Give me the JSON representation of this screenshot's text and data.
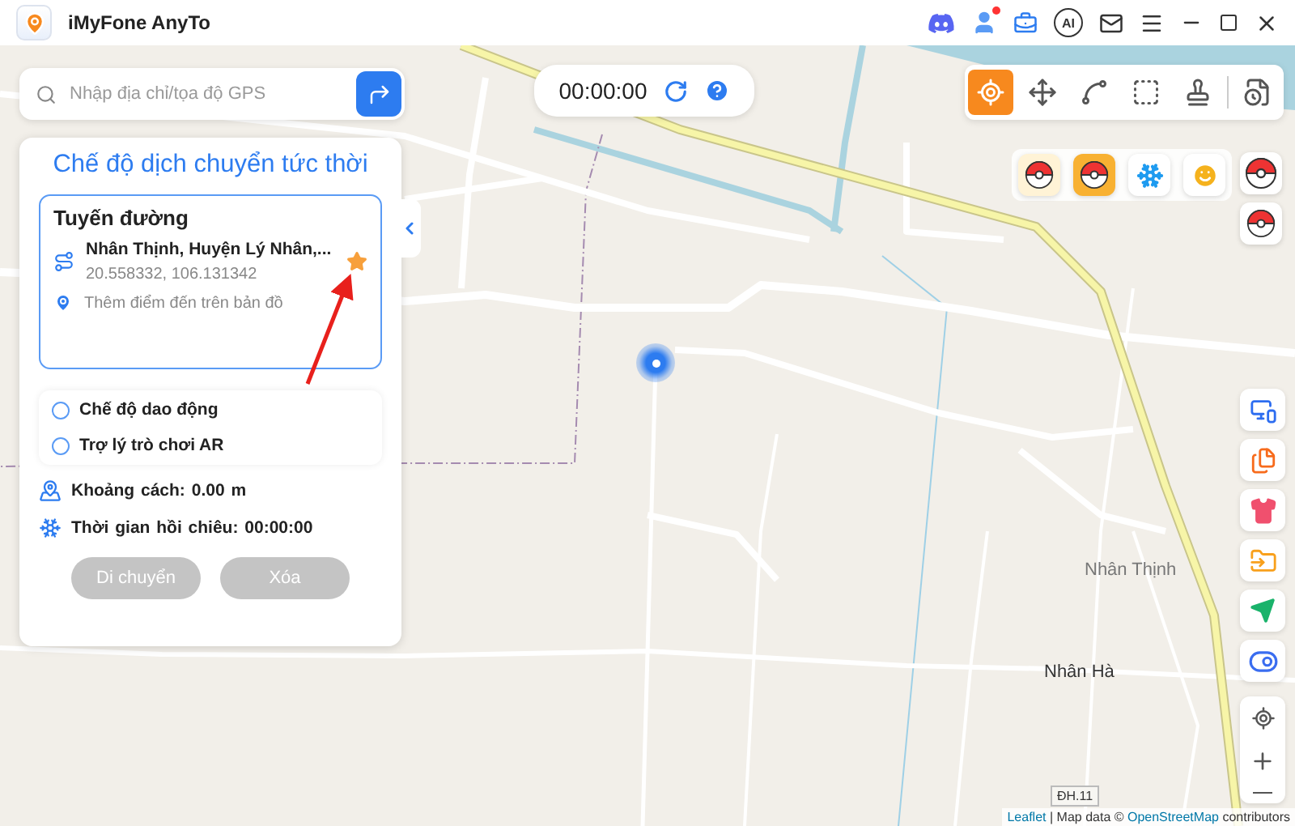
{
  "window": {
    "title": "iMyFone AnyTo",
    "ai_label": "AI"
  },
  "search": {
    "placeholder": "Nhập địa chỉ/tọa độ GPS"
  },
  "timer": {
    "value": "00:00:00"
  },
  "mode_toolbar": [
    {
      "kind": "teleport",
      "selected": true
    },
    {
      "kind": "move",
      "selected": false
    },
    {
      "kind": "route",
      "selected": false
    },
    {
      "kind": "area",
      "selected": false
    },
    {
      "kind": "stamp",
      "selected": false
    },
    {
      "kind": "history",
      "selected": false
    }
  ],
  "panel": {
    "title": "Chế độ dịch chuyển tức thời",
    "route": {
      "heading": "Tuyến đường",
      "start_name": "Nhân Thịnh, Huyện Lý Nhân,...",
      "start_coords": "20.558332, 106.131342",
      "favorite": true,
      "destination_placeholder": "Thêm điểm đến trên bản đồ"
    },
    "options": [
      {
        "label": "Chế độ dao động",
        "checked": false
      },
      {
        "label": "Trợ lý trò chơi AR",
        "checked": false
      }
    ],
    "stats": [
      {
        "kind": "distance",
        "label": "Khoảng cách:",
        "value": "0.00 m"
      },
      {
        "kind": "cooldown",
        "label": "Thời gian hồi chiêu:",
        "value": "00:00:00"
      }
    ],
    "buttons": [
      {
        "label": "Di chuyển",
        "disabled": true
      },
      {
        "label": "Xóa",
        "disabled": true
      }
    ]
  },
  "map": {
    "labels": [
      {
        "text": "Nhân Thịnh",
        "kind": "village"
      },
      {
        "text": "Nhân Hà",
        "kind": "town"
      },
      {
        "text": "ĐH.11",
        "kind": "road"
      }
    ],
    "attribution": [
      {
        "kind": "link",
        "text": "Leaflet"
      },
      {
        "kind": "text",
        "text": " | Map data © "
      },
      {
        "kind": "link",
        "text": "OpenStreetMap"
      },
      {
        "kind": "text",
        "text": " contributors"
      }
    ]
  }
}
